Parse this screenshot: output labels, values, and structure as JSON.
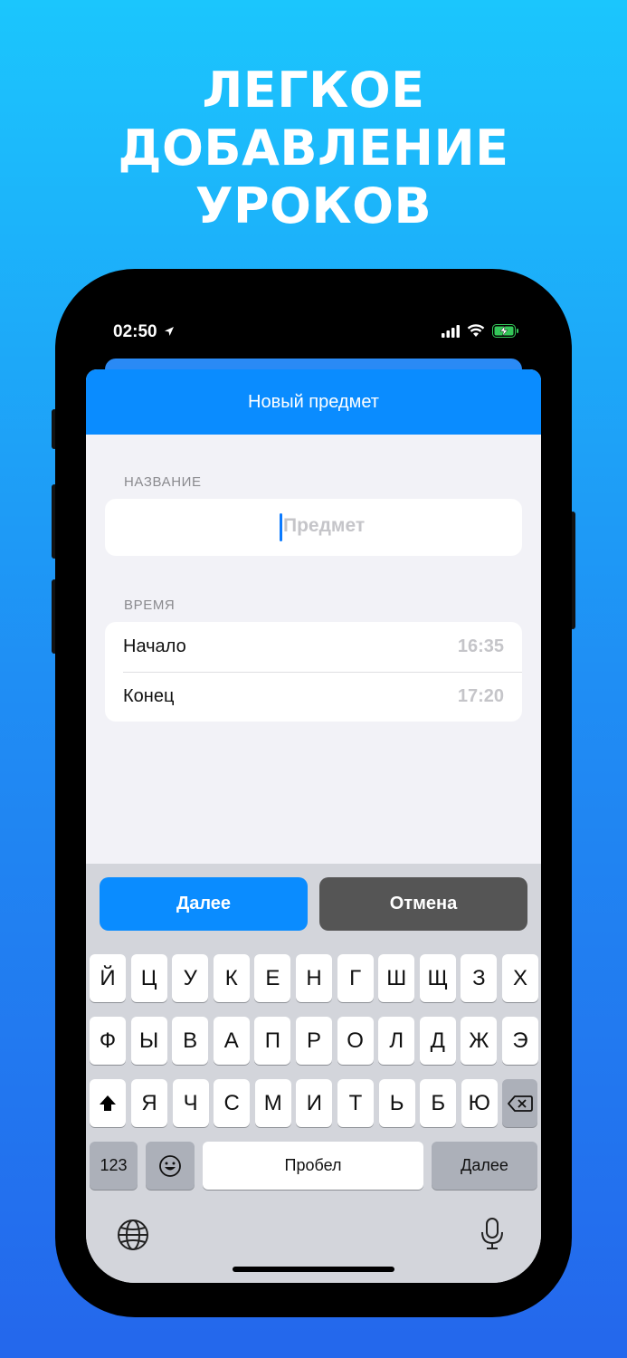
{
  "headline": [
    "ЛЕГКОЕ",
    "ДОБАВЛЕНИЕ",
    "УРОКОВ"
  ],
  "status": {
    "time": "02:50"
  },
  "nav": {
    "title": "Новый предмет"
  },
  "name_section": {
    "label": "НАЗВАНИЕ",
    "placeholder": "Предмет",
    "value": ""
  },
  "time_section": {
    "label": "ВРЕМЯ",
    "rows": [
      {
        "label": "Начало",
        "value": "16:35"
      },
      {
        "label": "Конец",
        "value": "17:20"
      }
    ]
  },
  "actions": {
    "next": "Далее",
    "cancel": "Отмена"
  },
  "keyboard": {
    "row1": [
      "Й",
      "Ц",
      "У",
      "К",
      "Е",
      "Н",
      "Г",
      "Ш",
      "Щ",
      "З",
      "Х"
    ],
    "row2": [
      "Ф",
      "Ы",
      "В",
      "А",
      "П",
      "Р",
      "О",
      "Л",
      "Д",
      "Ж",
      "Э"
    ],
    "row3": [
      "Я",
      "Ч",
      "С",
      "М",
      "И",
      "Т",
      "Ь",
      "Б",
      "Ю"
    ],
    "numbers": "123",
    "space": "Пробел",
    "return": "Далее"
  },
  "colors": {
    "accent": "#0a8cff",
    "cancel_button": "#555555",
    "placeholder": "#c5c5c9"
  },
  "icons": [
    "location-arrow-icon",
    "signal-icon",
    "wifi-icon",
    "battery-charging-icon",
    "shift-icon",
    "backspace-icon",
    "emoji-icon",
    "globe-icon",
    "microphone-icon"
  ]
}
